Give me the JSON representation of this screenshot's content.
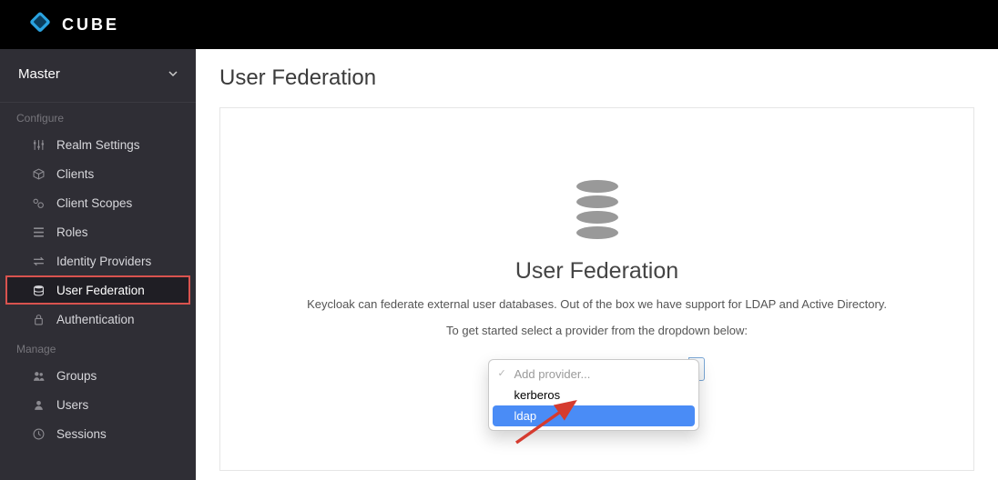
{
  "brand": {
    "name": "CUBE"
  },
  "realm": {
    "name": "Master"
  },
  "sidebar": {
    "configure_label": "Configure",
    "manage_label": "Manage",
    "configure": [
      {
        "label": "Realm Settings",
        "icon": "sliders"
      },
      {
        "label": "Clients",
        "icon": "cube"
      },
      {
        "label": "Client Scopes",
        "icon": "scopes"
      },
      {
        "label": "Roles",
        "icon": "list"
      },
      {
        "label": "Identity Providers",
        "icon": "exchange"
      },
      {
        "label": "User Federation",
        "icon": "database"
      },
      {
        "label": "Authentication",
        "icon": "lock"
      }
    ],
    "manage": [
      {
        "label": "Groups",
        "icon": "users"
      },
      {
        "label": "Users",
        "icon": "user"
      },
      {
        "label": "Sessions",
        "icon": "clock"
      }
    ]
  },
  "page": {
    "title": "User Federation",
    "heading": "User Federation",
    "description": "Keycloak can federate external user databases. Out of the box we have support for LDAP and Active Directory.",
    "hint": "To get started select a provider from the dropdown below:"
  },
  "dropdown": {
    "placeholder": "Add provider...",
    "options": [
      "kerberos",
      "ldap"
    ],
    "hovered": "ldap"
  }
}
